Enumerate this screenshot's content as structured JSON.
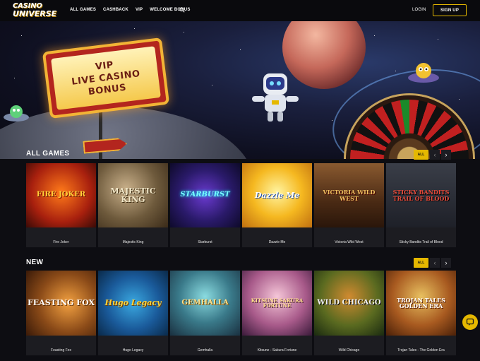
{
  "header": {
    "logo_line1": "CASINO",
    "logo_line2": "UNIVERSE",
    "nav": [
      "ALL GAMES",
      "CASHBACK",
      "VIP",
      "WELCOME BONUS"
    ],
    "login": "LOGIN",
    "signup": "SIGN UP"
  },
  "hero": {
    "line1": "VIP",
    "line2": "LIVE CASINO",
    "line3": "BONUS"
  },
  "colors": {
    "accent": "#e5b800",
    "background": "#0d0d12",
    "card": "#1c1c21"
  },
  "sections": [
    {
      "title": "ALL GAMES",
      "all_label": "ALL",
      "prev": "‹",
      "next": "›",
      "games": [
        {
          "name": "Fire Joker",
          "art": "FIRE JOKER"
        },
        {
          "name": "Majestic King",
          "art": "MAJESTIC KING"
        },
        {
          "name": "Starburst",
          "art": "STARBURST"
        },
        {
          "name": "Dazzle Me",
          "art": "Dazzle Me"
        },
        {
          "name": "Victoria Wild West",
          "art": "VICTORIA WILD WEST"
        },
        {
          "name": "Sticky Bandits Trail of Blood",
          "art": "STICKY BANDITS TRAIL OF BLOOD"
        }
      ]
    },
    {
      "title": "NEW",
      "all_label": "ALL",
      "prev": "‹",
      "next": "›",
      "games": [
        {
          "name": "Feasting Fox",
          "art": "FEASTING FOX"
        },
        {
          "name": "Hugo Legacy",
          "art": "Hugo Legacy"
        },
        {
          "name": "Gemhalla",
          "art": "GEMHALLA"
        },
        {
          "name": "Kitsune - Sakura Fortune",
          "art": "KITSUNE SAKURA FORTUNE"
        },
        {
          "name": "Wild Chicago",
          "art": "WILD CHICAGO"
        },
        {
          "name": "Trojan Tales - The Golden Era",
          "art": "TROJAN TALES GOLDEN ERA"
        }
      ]
    }
  ]
}
